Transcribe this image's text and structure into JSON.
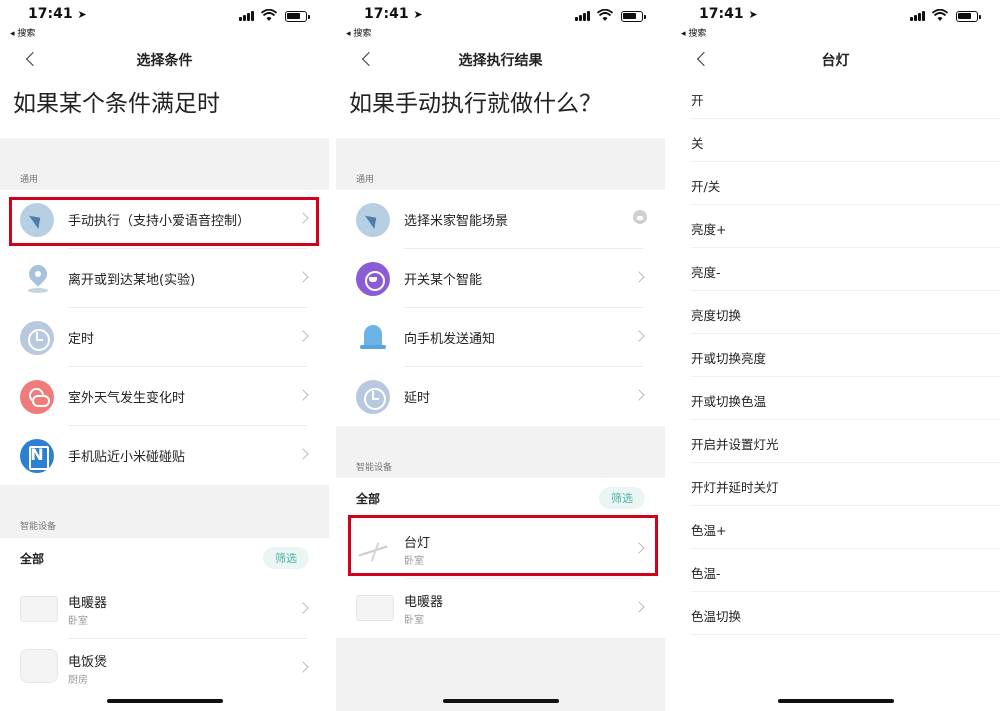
{
  "status_bar": {
    "time": "17:41",
    "back_app": "◂ 搜索"
  },
  "panels": [
    {
      "nav_title": "选择条件",
      "headline": "如果某个条件满足时",
      "general_label": "通用",
      "items": [
        {
          "label": "手动执行（支持小爱语音控制）",
          "icon": "cursor-icon"
        },
        {
          "label": "离开或到达某地(实验)",
          "icon": "location-icon"
        },
        {
          "label": "定时",
          "icon": "clock-icon"
        },
        {
          "label": "室外天气发生变化时",
          "icon": "weather-icon"
        },
        {
          "label": "手机贴近小米碰碰贴",
          "icon": "nfc-icon"
        }
      ],
      "devices_label": "智能设备",
      "all_label": "全部",
      "filter_label": "筛选",
      "devices": [
        {
          "name": "电暖器",
          "room": "卧室"
        },
        {
          "name": "电饭煲",
          "room": "厨房"
        }
      ]
    },
    {
      "nav_title": "选择执行结果",
      "headline": "如果手动执行就做什么？",
      "general_label": "通用",
      "items": [
        {
          "label": "选择米家智能场景",
          "icon": "scene-icon"
        },
        {
          "label": "开关某个智能",
          "icon": "smart-icon"
        },
        {
          "label": "向手机发送通知",
          "icon": "bell-icon"
        },
        {
          "label": "延时",
          "icon": "delay-icon"
        }
      ],
      "devices_label": "智能设备",
      "all_label": "全部",
      "filter_label": "筛选",
      "devices": [
        {
          "name": "台灯",
          "room": "卧室"
        },
        {
          "name": "电暖器",
          "room": "卧室"
        }
      ]
    },
    {
      "nav_title": "台灯",
      "options": [
        "开",
        "关",
        "开/关",
        "亮度+",
        "亮度-",
        "亮度切换",
        "开或切换亮度",
        "开或切换色温",
        "开启并设置灯光",
        "开灯并延时关灯",
        "色温+",
        "色温-",
        "色温切换"
      ]
    }
  ],
  "highlight_color": "#d0021b",
  "accent_color": "#4fb3a8"
}
